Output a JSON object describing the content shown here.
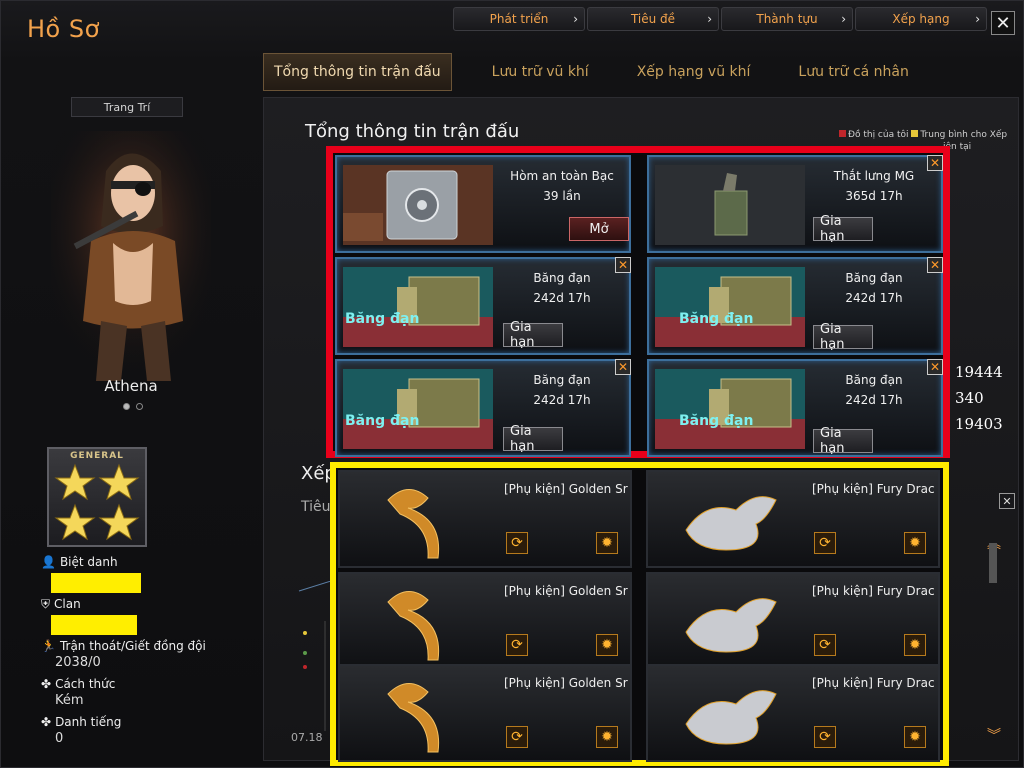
{
  "window": {
    "title": "Hồ Sơ"
  },
  "top_nav": [
    {
      "label": "Phát triển"
    },
    {
      "label": "Tiêu đề"
    },
    {
      "label": "Thành tựu"
    },
    {
      "label": "Xếp hạng"
    }
  ],
  "tabs": [
    {
      "label": "Tổng thông tin trận đấu",
      "active": true
    },
    {
      "label": "Lưu trữ vũ khí"
    },
    {
      "label": "Xếp hạng vũ khí"
    },
    {
      "label": "Lưu trữ cá nhân"
    }
  ],
  "left": {
    "decorate_label": "Trang Trí",
    "character_name": "Athena",
    "rank_label": "GENERAL",
    "fields": [
      {
        "label": "Biệt danh",
        "value": ""
      },
      {
        "label": "Clan",
        "value": ""
      },
      {
        "label": "Trận thoát/Giết đồng đội",
        "value": "2038/0"
      },
      {
        "label": "Cách thức",
        "value": "Kém"
      },
      {
        "label": "Danh tiếng",
        "value": "0"
      }
    ]
  },
  "main": {
    "title": "Tổng thông tin trận đấu",
    "legend": {
      "mine": "Đồ thị của tôi",
      "avg": "Trung bình cho Xếp",
      "avg2": "iện tại"
    },
    "side_numbers": [
      "19444",
      "340",
      "19403"
    ],
    "under_title": "Xếp",
    "under_sub": "Tiêu",
    "date_label": "07.18"
  },
  "inventory": [
    {
      "name": "Hòm an toàn Bạc",
      "detail": "39 lần",
      "button": "Mở",
      "icon": "safe-icon"
    },
    {
      "name": "Thắt lưng MG",
      "detail": "365d 17h",
      "button": "Gia hạn",
      "icon": "mg-belt-icon"
    },
    {
      "name": "Băng đạn",
      "detail": "242d 17h",
      "button": "Gia hạn",
      "icon": "ammo-icon",
      "thumb_text": "Băng đạn"
    },
    {
      "name": "Băng đạn",
      "detail": "242d 17h",
      "button": "Gia hạn",
      "icon": "ammo-icon",
      "thumb_text": "Băng đạn"
    },
    {
      "name": "Băng đạn",
      "detail": "242d 17h",
      "button": "Gia hạn",
      "icon": "ammo-icon",
      "thumb_text": "Băng đạn"
    },
    {
      "name": "Băng đạn",
      "detail": "242d 17h",
      "button": "Gia hạn",
      "icon": "ammo-icon",
      "thumb_text": "Băng đạn"
    }
  ],
  "accessories": [
    {
      "name": "[Phụ kiện] Golden Sr",
      "icon": "golden-snake-icon"
    },
    {
      "name": "[Phụ kiện] Fury Drac",
      "icon": "fury-dragon-icon"
    },
    {
      "name": "[Phụ kiện] Golden Sr",
      "icon": "golden-snake-icon"
    },
    {
      "name": "[Phụ kiện] Fury Drac",
      "icon": "fury-dragon-icon"
    },
    {
      "name": "[Phụ kiện] Golden Sr",
      "icon": "golden-snake-icon"
    },
    {
      "name": "[Phụ kiện] Fury Drac",
      "icon": "fury-dragon-icon"
    }
  ],
  "colors": {
    "accent": "#f2a24c",
    "highlight_red": "#e8001a",
    "highlight_yellow": "#ffeb00",
    "redact": "#ffee00"
  }
}
